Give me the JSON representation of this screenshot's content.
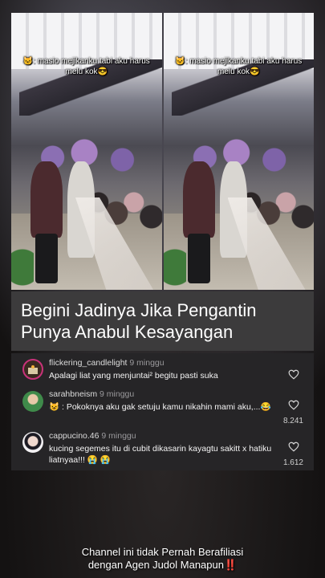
{
  "video": {
    "overlay_caption_left": "🐱: masio mejikanku tabi aku harus melu kok😎",
    "overlay_caption_right": "🐱: masio mejikanku tabi aku harus melu kok😎"
  },
  "headline": "Begini Jadinya Jika Pengantin Punya Anabul Kesayangan",
  "comments": [
    {
      "username": "flickering_candlelight",
      "time": "9 minggu",
      "text": "Apalagi liat yang menjuntai² begitu pasti suka",
      "likes": "",
      "avatar_icon": "candle-avatar-icon"
    },
    {
      "username": "sarahbneism",
      "time": "9 minggu",
      "text": "😺 : Pokoknya aku gak setuju kamu nikahin mami aku,...😂",
      "likes": "8.241",
      "avatar_icon": "woman-green-hijab-avatar-icon"
    },
    {
      "username": "cappucino.46",
      "time": "9 minggu",
      "text": "kucing segemes itu di cubit dikasarin kayagtu sakitt x hatiku liatnyaa!!! 😭 😭",
      "likes": "1.612",
      "avatar_icon": "anime-girl-avatar-icon"
    }
  ],
  "footer": {
    "line1": "Channel ini tidak Pernah Berafiliasi",
    "line2": "dengan Agen Judol Manapun‼️"
  },
  "colors": {
    "headline_bg": "#3c3b3c",
    "comments_bg": "#262527",
    "text": "#ffffff"
  }
}
